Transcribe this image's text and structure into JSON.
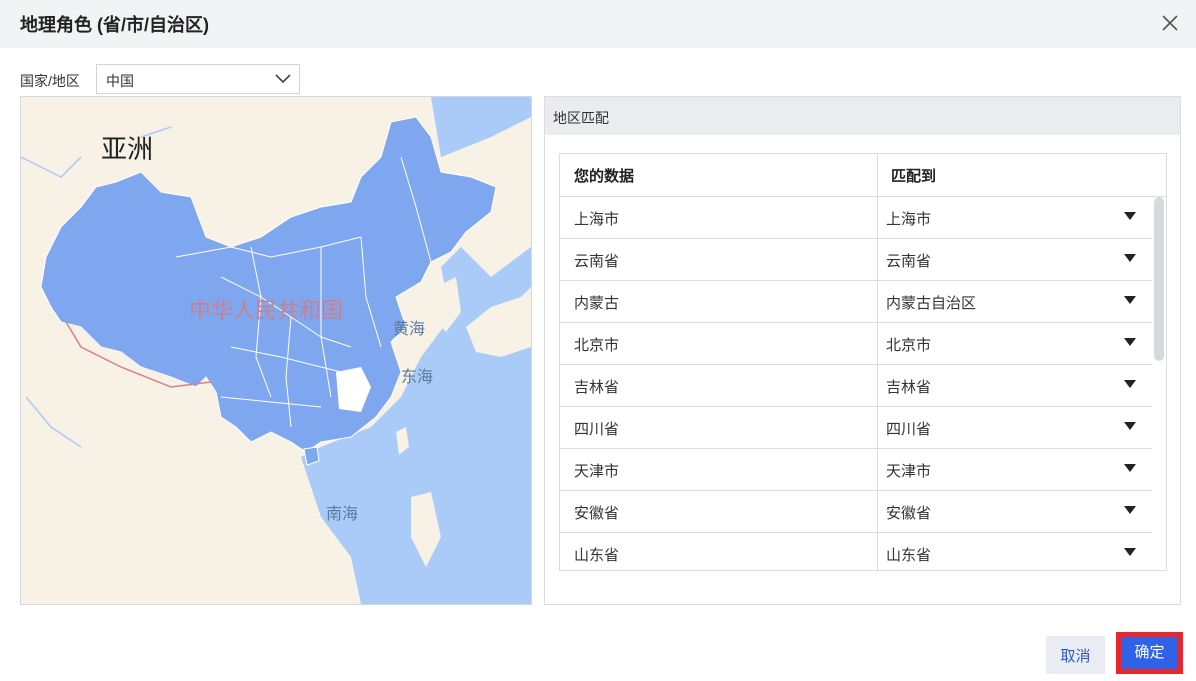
{
  "dialog": {
    "title": "地理角色 (省/市/自治区)"
  },
  "country": {
    "label": "国家/地区",
    "selected": "中国"
  },
  "map": {
    "continent_label": "亚洲",
    "country_label": "中华人民共和国",
    "sea_labels": [
      "黄海",
      "东海",
      "南海"
    ],
    "highlight_color": "#7ea7f0",
    "land_color": "#f7f1e6",
    "water_color": "#aacbf7"
  },
  "match_panel": {
    "title": "地区匹配",
    "columns": [
      "您的数据",
      "匹配到"
    ],
    "rows": [
      {
        "data": "上海市",
        "match": "上海市"
      },
      {
        "data": "云南省",
        "match": "云南省"
      },
      {
        "data": "内蒙古",
        "match": "内蒙古自治区"
      },
      {
        "data": "北京市",
        "match": "北京市"
      },
      {
        "data": "吉林省",
        "match": "吉林省"
      },
      {
        "data": "四川省",
        "match": "四川省"
      },
      {
        "data": "天津市",
        "match": "天津市"
      },
      {
        "data": "安徽省",
        "match": "安徽省"
      },
      {
        "data": "山东省",
        "match": "山东省"
      }
    ]
  },
  "footer": {
    "cancel_label": "取消",
    "ok_label": "确定"
  },
  "colors": {
    "primary": "#2f62e6",
    "highlight_border": "#e8262d"
  }
}
